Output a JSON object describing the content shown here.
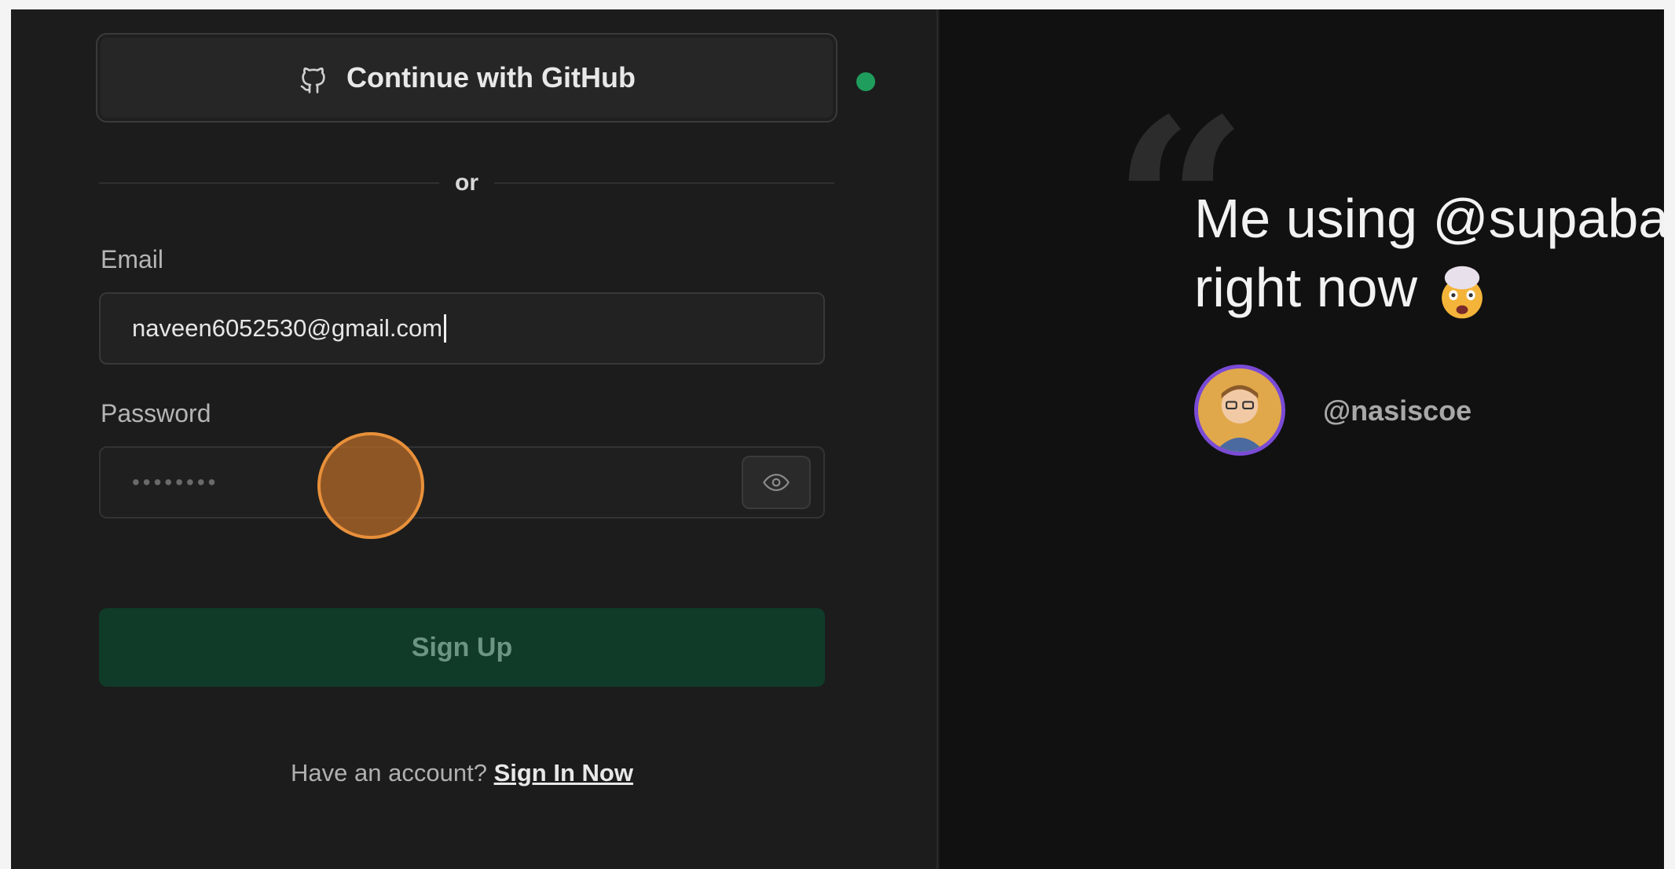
{
  "auth": {
    "github_label": "Continue with GitHub",
    "divider_text": "or",
    "email_label": "Email",
    "email_value": "naveen6052530@gmail.com",
    "password_label": "Password",
    "password_masked": "••••••••",
    "signup_label": "Sign Up",
    "footer_prompt": "Have an account?",
    "signin_link": "Sign In Now"
  },
  "testimonial": {
    "line1": "Me using @supaba",
    "line2": "right now",
    "handle": "@nasiscoe"
  },
  "icons": {
    "github": "github-icon",
    "eye": "eye-icon",
    "emoji": "exploding-head-emoji",
    "zoom": "zoom-in-icon"
  },
  "colors": {
    "brand_green": "#0f3b28",
    "status_dot": "#1f9d5c",
    "avatar_ring": "#7a4bd6",
    "cursor_highlight": "#e8903a"
  }
}
